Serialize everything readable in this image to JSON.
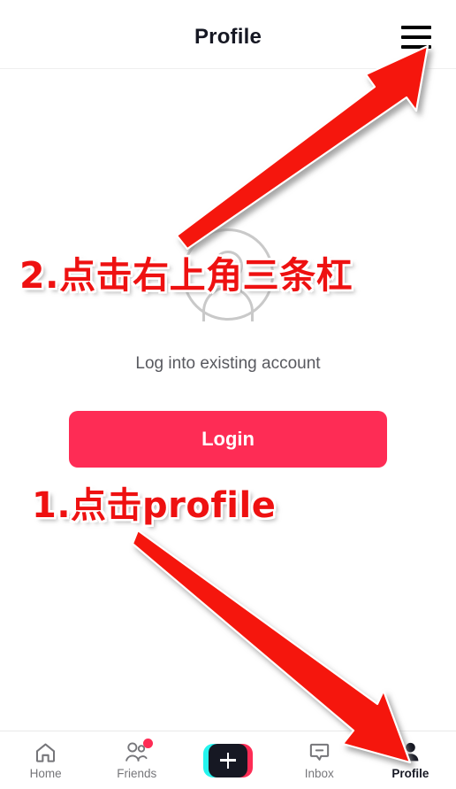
{
  "app": {
    "platform": "tiktok-mobile",
    "accent_color": "#fe2c55",
    "cyan_color": "#25f4ee",
    "dark_color": "#161823",
    "annotation_color": "#ee1111"
  },
  "status_bar": {
    "pill": ""
  },
  "header": {
    "title": "Profile",
    "menu_icon": "hamburger-icon"
  },
  "main": {
    "avatar_icon": "avatar-placeholder-icon",
    "login_hint": "Log into existing account",
    "login_button_label": "Login"
  },
  "annotations": [
    {
      "id": "step-2",
      "text": "2.点击右上角三条杠",
      "points_to": "hamburger-menu"
    },
    {
      "id": "step-1",
      "text": "1.点击profile",
      "points_to": "profile-tab"
    }
  ],
  "bottom_nav": {
    "items": [
      {
        "label": "Home",
        "icon": "home-icon",
        "active": false,
        "badge": false
      },
      {
        "label": "Friends",
        "icon": "friends-icon",
        "active": false,
        "badge": true
      },
      {
        "label": "",
        "icon": "plus-icon",
        "active": false,
        "badge": false
      },
      {
        "label": "Inbox",
        "icon": "inbox-icon",
        "active": false,
        "badge": false
      },
      {
        "label": "Profile",
        "icon": "profile-icon",
        "active": true,
        "badge": false
      }
    ]
  }
}
